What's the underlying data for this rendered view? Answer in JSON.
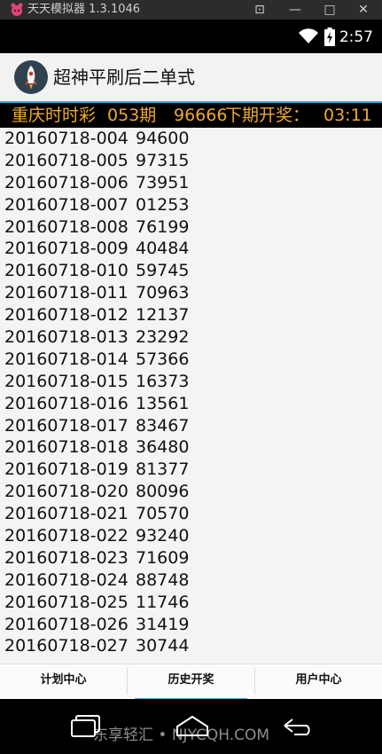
{
  "emulator": {
    "title": "天天模拟器 1.3.1046",
    "buttons": {
      "restore": "⊡",
      "minimize": "—",
      "maximize": "□",
      "close": "✕"
    }
  },
  "status_bar": {
    "time": "2:57",
    "icons": [
      "wifi-icon",
      "battery-icon"
    ]
  },
  "app_bar": {
    "title": "超神平刷后二单式",
    "icon": "rocket-icon"
  },
  "ticker": {
    "lottery": "重庆时时彩",
    "period": "053期",
    "number": "96666",
    "next_label": "下期开奖：",
    "countdown": "03:11"
  },
  "draws": [
    {
      "issue": "20160718-004",
      "number": "94600"
    },
    {
      "issue": "20160718-005",
      "number": "97315"
    },
    {
      "issue": "20160718-006",
      "number": "73951"
    },
    {
      "issue": "20160718-007",
      "number": "01253"
    },
    {
      "issue": "20160718-008",
      "number": "76199"
    },
    {
      "issue": "20160718-009",
      "number": "40484"
    },
    {
      "issue": "20160718-010",
      "number": "59745"
    },
    {
      "issue": "20160718-011",
      "number": "70963"
    },
    {
      "issue": "20160718-012",
      "number": "12137"
    },
    {
      "issue": "20160718-013",
      "number": "23292"
    },
    {
      "issue": "20160718-014",
      "number": "57366"
    },
    {
      "issue": "20160718-015",
      "number": "16373"
    },
    {
      "issue": "20160718-016",
      "number": "13561"
    },
    {
      "issue": "20160718-017",
      "number": "83467"
    },
    {
      "issue": "20160718-018",
      "number": "36480"
    },
    {
      "issue": "20160718-019",
      "number": "81377"
    },
    {
      "issue": "20160718-020",
      "number": "80096"
    },
    {
      "issue": "20160718-021",
      "number": "70570"
    },
    {
      "issue": "20160718-022",
      "number": "93240"
    },
    {
      "issue": "20160718-023",
      "number": "71609"
    },
    {
      "issue": "20160718-024",
      "number": "88748"
    },
    {
      "issue": "20160718-025",
      "number": "11746"
    },
    {
      "issue": "20160718-026",
      "number": "31419"
    },
    {
      "issue": "20160718-027",
      "number": "30744"
    }
  ],
  "tabs": [
    {
      "label": "计划中心",
      "active": false
    },
    {
      "label": "历史开奖",
      "active": true
    },
    {
      "label": "用户中心",
      "active": false
    }
  ],
  "nav_bar": {
    "icons": [
      "recent-apps-icon",
      "home-icon",
      "back-icon"
    ],
    "watermark": "东享轻汇 • NJYCQH.COM"
  },
  "colors": {
    "accent": "#4aa6d6",
    "ticker_text": "#f0a932",
    "list_bg": "#f4f4f4"
  }
}
